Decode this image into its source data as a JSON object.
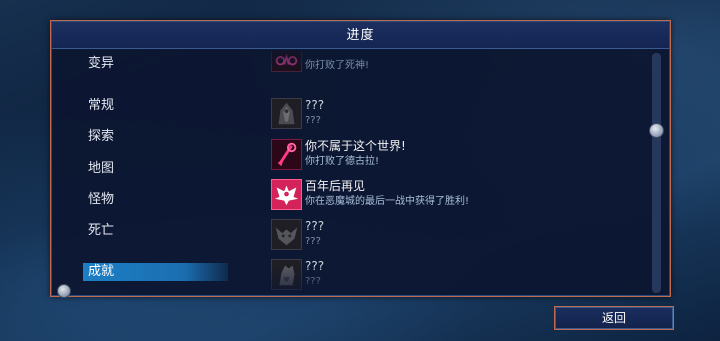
{
  "header": {
    "title": "进度"
  },
  "sidebar": {
    "items": [
      {
        "label": "变异"
      },
      {
        "label": "常规"
      },
      {
        "label": "探索"
      },
      {
        "label": "地图"
      },
      {
        "label": "怪物"
      },
      {
        "label": "死亡"
      },
      {
        "label": "成就"
      }
    ],
    "active_index": 6
  },
  "achievements": [
    {
      "title": "",
      "desc": "你打败了死神!",
      "icon": "reaper-icon",
      "locked": false
    },
    {
      "title": "???",
      "desc": "???",
      "icon": "hooded-figure-icon",
      "locked": true
    },
    {
      "title": "你不属于这个世界!",
      "desc": "你打败了德古拉!",
      "icon": "vampire-icon",
      "locked": false
    },
    {
      "title": "百年后再见",
      "desc": "你在恶魔城的最后一战中获得了胜利!",
      "icon": "bat-wings-icon",
      "locked": false
    },
    {
      "title": "???",
      "desc": "???",
      "icon": "demon-icon",
      "locked": true
    },
    {
      "title": "???",
      "desc": "???",
      "icon": "beast-icon",
      "locked": true
    },
    {
      "title": "",
      "desc": "",
      "icon": "partial-icon",
      "locked": true
    }
  ],
  "footer": {
    "back_label": "返回"
  },
  "colors": {
    "accent_border": "#c0694c",
    "active_tab": "#1e7fc4",
    "panel_bg": "#0c1630",
    "unlocked_icon_glow": "#e0245e"
  }
}
